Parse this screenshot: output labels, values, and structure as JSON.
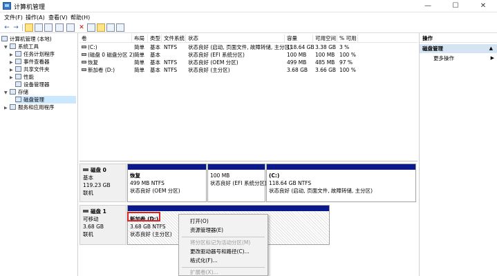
{
  "window": {
    "title": "计算机管理",
    "minimize": "—",
    "maximize": "☐",
    "close": "✕"
  },
  "menu": [
    "文件(F)",
    "操作(A)",
    "查看(V)",
    "帮助(H)"
  ],
  "toolbar": {
    "back": "←",
    "forward": "→",
    "delete": "✕",
    "icons": [
      "folder-icon",
      "grid-icon",
      "properties-icon",
      "help-icon",
      "refresh-icon",
      "check-icon",
      "export-icon",
      "view-icon",
      "delete-icon"
    ]
  },
  "tree": {
    "root": "计算机管理 (本地)",
    "system_tools": "系统工具",
    "task_scheduler": "任务计划程序",
    "event_viewer": "事件查看器",
    "shared_folders": "共享文件夹",
    "performance": "性能",
    "device_manager": "设备管理器",
    "storage": "存储",
    "disk_management": "磁盘管理",
    "services_apps": "服务和应用程序"
  },
  "volume_list": {
    "headers": [
      "卷",
      "布局",
      "类型",
      "文件系统",
      "状态",
      "容量",
      "可用空间",
      "% 可用"
    ],
    "rows": [
      [
        "(C:)",
        "简单",
        "基本",
        "NTFS",
        "状态良好 (启动, 页面文件, 故障转储, 主分区)",
        "118.64 GB",
        "3.38 GB",
        "3 %"
      ],
      [
        "(磁盘 0 磁盘分区 2)",
        "简单",
        "基本",
        "",
        "状态良好 (EFI 系统分区)",
        "100 MB",
        "100 MB",
        "100 %"
      ],
      [
        "恢复",
        "简单",
        "基本",
        "NTFS",
        "状态良好 (OEM 分区)",
        "499 MB",
        "485 MB",
        "97 %"
      ],
      [
        "新加卷 (D:)",
        "简单",
        "基本",
        "NTFS",
        "状态良好 (主分区)",
        "3.68 GB",
        "3.66 GB",
        "100 %"
      ]
    ]
  },
  "disk0": {
    "name": "磁盘 0",
    "type": "基本",
    "size": "119.23 GB",
    "status": "联机",
    "partitions": [
      {
        "name": "恢复",
        "size": "499 MB NTFS",
        "status": "状态良好 (OEM 分区)"
      },
      {
        "name": "",
        "size": "100 MB",
        "status": "状态良好 (EFI 系统分区)"
      },
      {
        "name": "(C:)",
        "size": "118.64 GB NTFS",
        "status": "状态良好 (启动, 页面文件, 故障转储, 主分区)"
      }
    ]
  },
  "disk1": {
    "name": "磁盘 1",
    "type": "可移动",
    "size": "3.68 GB",
    "status": "联机",
    "partition": {
      "name": "新加卷  (D:)",
      "size": "3.68 GB NTFS",
      "status": "状态良好 (主分区)"
    }
  },
  "context_menu": {
    "open": "打开(O)",
    "explorer": "资源管理器(E)",
    "mark_active": "将分区标记为活动分区(M)",
    "change_letter": "更改驱动器号和路径(C)...",
    "format": "格式化(F)...",
    "extend": "扩展卷(X)..."
  },
  "actions": {
    "header": "操作",
    "section": "磁盘管理",
    "more": "更多操作",
    "section_arrow": "▲",
    "more_arrow": "▶"
  },
  "colors": {
    "partition_bar": "#0a1a8a",
    "highlight": "#e02020",
    "selection": "#cce8ff"
  }
}
